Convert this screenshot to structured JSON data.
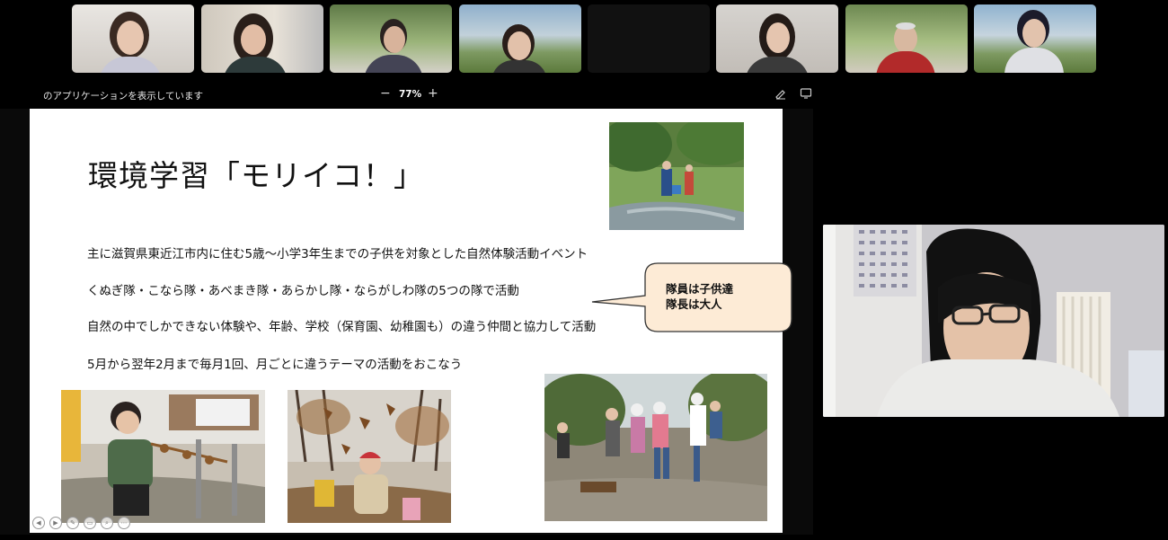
{
  "participants": [
    {
      "id": "p1",
      "tile": "participant-tile-1"
    },
    {
      "id": "p2",
      "tile": "participant-tile-2"
    },
    {
      "id": "p3",
      "tile": "participant-tile-3"
    },
    {
      "id": "p4",
      "tile": "participant-tile-4"
    },
    {
      "id": "p5",
      "tile": "participant-tile-5"
    },
    {
      "id": "p6",
      "tile": "participant-tile-6"
    },
    {
      "id": "p7",
      "tile": "participant-tile-7"
    },
    {
      "id": "p8",
      "tile": "participant-tile-8"
    }
  ],
  "share_bar": {
    "text": "のアプリケーションを表示しています",
    "zoom_minus": "−",
    "zoom_level": "77%",
    "zoom_plus": "+"
  },
  "slide": {
    "title": "環境学習「モリイコ！」",
    "bullets": [
      "主に滋賀県東近江市内に住む5歳～小学3年生までの子供を対象とした自然体験活動イベント",
      "くぬぎ隊・こなら隊・あべまき隊・あらかし隊・ならがしわ隊の5つの隊で活動",
      "自然の中でしかできない体験や、年齢、学校（保育園、幼稚園も）の違う仲間と協力して活動",
      "5月から翌年2月まで毎月1回、月ごとに違うテーマの活動をおこなう"
    ],
    "callout": {
      "line1": "隊員は子供達",
      "line2": "隊長は大人"
    },
    "controls": [
      "◀",
      "▶",
      "✎",
      "▭",
      "⌕",
      "⋯"
    ]
  },
  "colors": {
    "background": "#000000",
    "slide_bg": "#ffffff",
    "callout_fill": "#fdebd6",
    "callout_stroke": "#333333"
  }
}
